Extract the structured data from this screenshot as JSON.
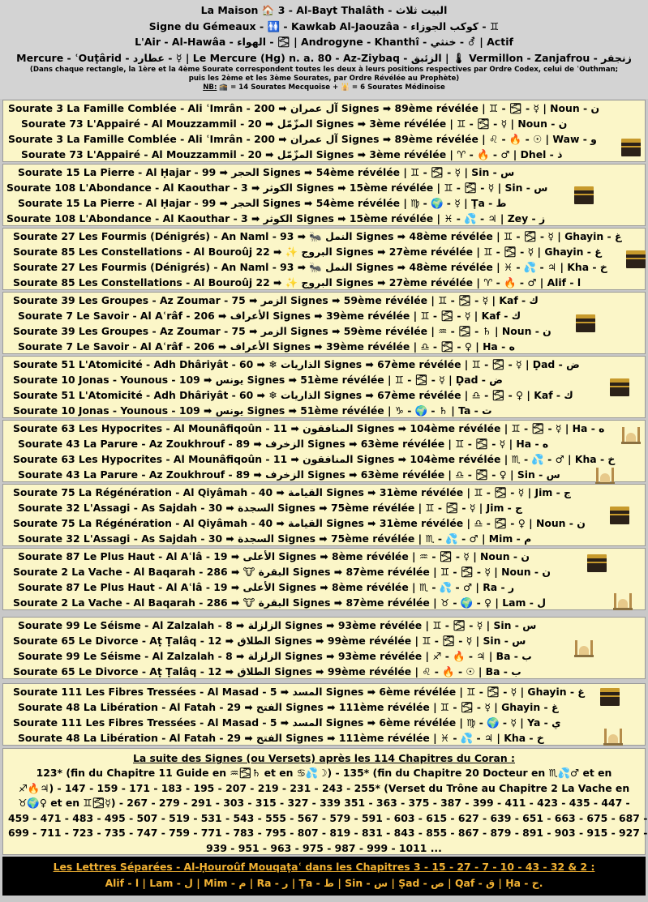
{
  "header": {
    "line1": "La Maison 🏠 3 - Al-Bayt Thalâth - البيت ثلاث",
    "line2": "Signe du Gémeaux - 🚻 - Kawkab Al-Jaouzâa - كوكب الجوزاء - ♊",
    "line3": "L'Air - Al-Hawâa - الهواء - 🌫 | Androgyne - Khanthî - خنثي - ⚦ | Actif",
    "line4": "Mercure - ʿOuṭârid - عطارد - ☿ | Le Mercure (Hg) n. a. 80 - Az-Ziybaq - الزئبق | 🌡 Vermillon - Zanjafrou - زنجفر",
    "note1": "(Dans chaque rectangle, la 1ère et la 4ème Sourate correspondent toutes les deux à leurs positions respectives par Ordre Codex, celui de ʿOuthman;",
    "note2": "puis les 2ème et les 3ème Sourates, par Ordre Révélée au Prophète)",
    "nb_label": "NB:",
    "nb_text": " 🕋 = 14 Sourates Mecquoise + 🕌 = 6 Sourates Médinoise"
  },
  "groups": [
    {
      "icon": "kaaba",
      "rows": [
        "Sourate 3 La Famille Comblée - Ali ʿImrân - آل عمران ➡ 200 Signes ➡ 89ème révélée | ♊ - 🌫 - ☿ | Noun - ن",
        "Sourate 73 L'Appairé - Al Mouzzammil - المزّمّل ➡ 20 Signes ➡ 3ème révélée | ♊ - 🌫 - ☿ | Noun - ن",
        "Sourate 3 La Famille Comblée - Ali ʿImrân - آل عمران ➡ 200 Signes ➡ 89ème révélée | ♌ - 🔥 - ☉ | Waw - و",
        "Sourate 73 L'Appairé - Al Mouzzammil - المزّمّل ➡ 20 Signes ➡ 3ème révélée | ♈ - 🔥 - ♂ | Dhel - ذ"
      ]
    },
    {
      "icon": "kaaba",
      "rows": [
        "Sourate 15 La Pierre - Al Ḥajar - الحجر ➡ 99 Signes ➡ 54ème révélée | ♊ - 🌫 - ☿ | Sin - س",
        "Sourate 108 L'Abondance - Al Kaouthar - الكوثر ➡ 3 Signes ➡ 15ème révélée | ♊ - 🌫 - ☿ | Sin - س",
        "Sourate 15 La Pierre - Al Ḥajar - الحجر ➡ 99 Signes ➡ 54ème révélée | ♍ - 🌍 - ☿ | Ṭa - ط",
        "Sourate 108 L'Abondance - Al Kaouthar - الكوثر ➡ 3 Signes ➡ 15ème révélée | ♓ - 💦 - ♃ | Zey - ز"
      ]
    },
    {
      "icon": "kaaba",
      "rows": [
        "Sourate 27 Les Fourmis (Dénigrés) - An Naml - النمل 🐜 ➡ 93 Signes ➡ 48ème révélée | ♊ - 🌫 - ☿ | Ghayin - غ",
        "Sourate 85 Les Constellations - Al Bouroûj البروج ✨ ➡ 22 Signes ➡ 27ème révélée | ♊ - 🌫 - ☿ | Ghayin - غ",
        "Sourate 27 Les Fourmis (Dénigrés) - An Naml - النمل 🐜 ➡ 93 Signes ➡ 48ème révélée | ♓ - 💦 - ♃ | Kha - خ",
        "Sourate 85 Les Constellations - Al Bouroûj البروج ✨ ➡ 22 Signes ➡ 27ème révélée | ♈ - 🔥 - ♂ | Alif - ا"
      ]
    },
    {
      "icon": "kaaba",
      "rows": [
        "Sourate 39 Les Groupes - Az Zoumar - الزمر ➡ 75 Signes ➡ 59ème révélée | ♊ - 🌫 - ☿ | Kaf - ك",
        "Sourate 7 Le Savoir - Al Aʿrâf - الأعراف ➡ 206 Signes ➡ 39ème révélée | ♊ - 🌫 - ☿ | Kaf - ك",
        "Sourate 39 Les Groupes - Az Zoumar - الزمر ➡ 75 Signes ➡ 59ème révélée | ♒ - 🌫 - ♄ | Noun - ن",
        "Sourate 7 Le Savoir - Al Aʿrâf - الأعراف ➡ 206 Signes ➡ 39ème révélée | ♎ - 🌫 - ♀ | Ha - ه"
      ]
    },
    {
      "icon": "kaaba",
      "rows": [
        "Sourate 51 L'Atomicité - Adh Dhâriyât - الذاريات ❄ ➡ 60 Signes ➡ 67ème révélée | ♊ - 🌫 - ☿ | Ḍad - ض",
        "Sourate 10 Jonas - Younous - يونس ➡ 109 Signes ➡ 51ème révélée | ♊ - 🌫 - ☿ | Ḍad - ض",
        "Sourate 51 L'Atomicité - Adh Dhâriyât - الذاريات ❄ ➡ 60 Signes ➡ 67ème révélée | ♎ - 🌫 - ♀ | Kaf - ك",
        "Sourate 10 Jonas - Younous - يونس ➡ 109 Signes ➡ 51ème révélée | ♑ - 🌍 - ♄ | Ta - ت"
      ]
    },
    {
      "icon": "mosque",
      "rows": [
        "Sourate 63 Les Hypocrites - Al Mounâfiqoûn - المنافقون ➡ 11 Signes ➡ 104ème révélée | ♊ - 🌫 - ☿ | Ha - ه",
        "Sourate 43 La Parure - Az Zoukhrouf - الزخرف ➡ 89 Signes ➡ 63ème révélée | ♊ - 🌫 - ☿ | Ha - ه",
        "Sourate 63 Les Hypocrites - Al Mounâfiqoûn - المنافقون ➡ 11 Signes ➡ 104ème révélée | ♏ - 💦 - ♂ | Kha - خ",
        "Sourate 43 La Parure - Az Zoukhrouf - الزخرف ➡ 89 Signes ➡ 63ème révélée | ♎ - 🌫 - ♀ | Sin - س"
      ]
    },
    {
      "icon": "kaaba",
      "rows": [
        "Sourate 75 La Régénération - Al Qiyâmah - القيامة ➡ 40 Signes ➡ 31ème révélée | ♊ - 🌫 - ☿ | Jim - ج",
        "Sourate 32 L'Assagi - As Sajdah - السجدة ➡ 30 Signes ➡ 75ème révélée | ♊ - 🌫 - ☿ | Jim - ج",
        "Sourate 75 La Régénération - Al Qiyâmah - القيامة ➡ 40 Signes ➡ 31ème révélée | ♎ - 🌫 - ♀ | Noun - ن",
        "Sourate 32 L'Assagi - As Sajdah - السجدة ➡ 30 Signes ➡ 75ème révélée | ♏ - 💦 - ♂ | Mim - م"
      ]
    },
    {
      "icon": "mosque",
      "rows": [
        "Sourate 87 Le Plus Haut - Al Aʿlâ - الأعلى ➡ 19 Signes ➡ 8ème révélée | ♒ - 🌫 - ☿ | Noun - ن",
        "Sourate 2 La Vache - Al Baqarah - البقرة 🐮 ➡ 286 Signes ➡ 87ème révélée | ♊ - 🌫 - ☿ | Noun - ن",
        "Sourate 87 Le Plus Haut - Al Aʿlâ - الأعلى ➡ 19 Signes ➡ 8ème révélée | ♏ - 💦 - ♂ | Ra - ر",
        "Sourate 2 La Vache - Al Baqarah - البقرة 🐮 ➡ 286 Signes ➡ 87ème révélée | ♉ - 🌍 - ♀ | Lam - ل"
      ]
    },
    {
      "icon": "mosque",
      "rows": [
        "Sourate 99 Le Séisme - Al Zalzalah - الزلزلة ➡ 8 Signes ➡ 93ème révélée | ♊ - 🌫 - ☿ | Sin - س",
        "Sourate 65 Le Divorce - Aṭ Ṭalâq - الطلاق ➡ 12 Signes ➡ 99ème révélée | ♊ - 🌫 - ☿ | Sin - س",
        "Sourate 99 Le Séisme - Al Zalzalah - الزلزلة ➡ 8 Signes ➡ 93ème révélée | ♐ - 🔥 - ♃ | Ba - ب",
        "Sourate 65 Le Divorce - Aṭ Ṭalâq - الطلاق ➡ 12 Signes ➡ 99ème révélée | ♌ - 🔥 - ☉ | Ba - ب"
      ]
    },
    {
      "icon": "mosque",
      "rows": [
        "Sourate 111 Les Fibres Tressées - Al Masad - المسد ➡ 5 Signes ➡ 6ème révélée | ♊ - 🌫 - ☿ | Ghayin - غ",
        "Sourate 48 La Libération - Al Fatah - الفتح ➡ 29 Signes ➡ 111ème révélée | ♊ - 🌫 - ☿ | Ghayin - غ",
        "Sourate 111 Les Fibres Tressées - Al Masad - المسد ➡ 5 Signes ➡ 6ème révélée | ♍ - 🌍 - ☿ | Ya - ي",
        "Sourate 48 La Libération - Al Fatah - الفتح ➡ 29 Signes ➡ 111ème révélée | ♓ - 💦 - ♃ | Kha - خ"
      ]
    }
  ],
  "suite": {
    "title": "La suite des Signes (ou Versets) après les 114 Chapitres du Coran :",
    "lines": [
      "123* (fin du Chapitre 11 Guide en ♒🌫♄ et en ♋💦☽) - 135* (fin du Chapitre 20 Docteur en ♏💦♂ et en",
      "♐🔥♃) - 147 - 159 - 171 - 183 - 195 - 207 - 219 - 231 - 243 - 255* (Verset du Trône au Chapitre 2 La Vache en",
      "♉🌍♀ et en ♊🌫☿) - 267 - 279 - 291 - 303 - 315 - 327 - 339  351 - 363 - 375 - 387 - 399 - 411 - 423 - 435 - 447 -",
      "459 - 471 - 483 - 495 - 507 - 519 - 531 - 543 - 555 - 567 - 579 - 591 - 603 - 615 - 627 - 639 - 651 - 663 - 675 - 687 -",
      "699 - 711 - 723 - 735 - 747 - 759 - 771 - 783 - 795 - 807 - 819 - 831 - 843 - 855 - 867 - 879 - 891 - 903 - 915 - 927 -",
      "939 - 951 - 963 - 975 - 987 - 999 - 1011 ..."
    ]
  },
  "lettres": {
    "title": "Les Lettres Séparées - Al-Ḥouroûf Mouqaṭaʿ dans les Chapitres 3 - 15 - 27 - 7 - 10 - 43 - 32 & 2 :",
    "body": "Alif - ا | Lam - ل | Mim - م | Ra - ر | Ṭa - ط | Sin - س | Ṣad - ص | Qaf - ق | Ḥa - ح."
  }
}
